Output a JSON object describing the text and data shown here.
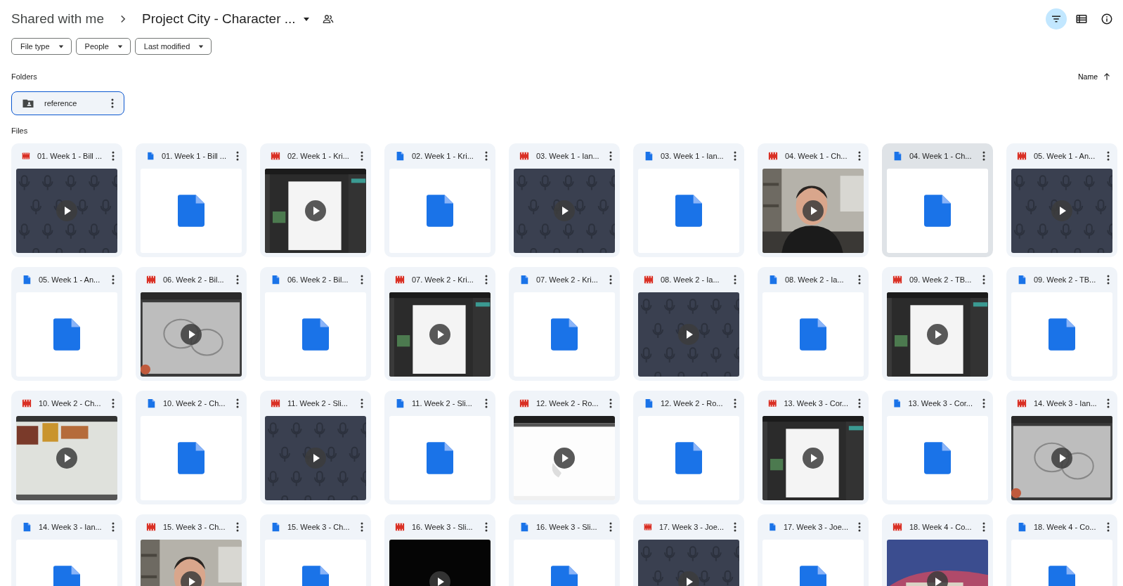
{
  "breadcrumb": [
    {
      "label": "Shared with me",
      "kind": "link"
    },
    {
      "label": "Project City - Character ...",
      "kind": "current"
    }
  ],
  "toolbar": [
    {
      "kind": "filter",
      "selected": true
    },
    {
      "kind": "list",
      "selected": false
    },
    {
      "kind": "info",
      "selected": false
    }
  ],
  "filters": [
    {
      "label": "File type"
    },
    {
      "label": "People"
    },
    {
      "label": "Last modified"
    }
  ],
  "folders_heading": "Folders",
  "sort": {
    "label": "Name"
  },
  "folders": [
    {
      "name": "reference",
      "selected": true
    }
  ],
  "files_heading": "Files",
  "files": [
    {
      "name": "01. Week 1 - Bill ...",
      "kind": "audio",
      "selected": false
    },
    {
      "name": "01. Week 1 - Bill ...",
      "kind": "doc",
      "selected": false
    },
    {
      "name": "02. Week 1 - Kri...",
      "kind": "video",
      "preview": {
        "kind": "app"
      },
      "selected": false
    },
    {
      "name": "02. Week 1 - Kri...",
      "kind": "doc",
      "selected": false
    },
    {
      "name": "03. Week 1 - Ian...",
      "kind": "audio",
      "selected": false
    },
    {
      "name": "03. Week 1 - Ian...",
      "kind": "doc",
      "selected": false
    },
    {
      "name": "04. Week 1 - Ch...",
      "kind": "video",
      "preview": {
        "kind": "room"
      },
      "selected": false
    },
    {
      "name": "04. Week 1 - Ch...",
      "kind": "doc",
      "selected": true
    },
    {
      "name": "05. Week 1 - An...",
      "kind": "audio",
      "selected": false
    },
    {
      "name": "05. Week 1 - An...",
      "kind": "doc",
      "selected": false
    },
    {
      "name": "06. Week 2 - Bil...",
      "kind": "video",
      "preview": {
        "kind": "sketch"
      },
      "selected": false
    },
    {
      "name": "06. Week 2 - Bil...",
      "kind": "doc",
      "selected": false
    },
    {
      "name": "07. Week 2 - Kri...",
      "kind": "video",
      "preview": {
        "kind": "app"
      },
      "selected": false
    },
    {
      "name": "07. Week 2 - Kri...",
      "kind": "doc",
      "selected": false
    },
    {
      "name": "08. Week 2 - Ia...",
      "kind": "audio",
      "selected": false
    },
    {
      "name": "08. Week 2 - Ia...",
      "kind": "doc",
      "selected": false
    },
    {
      "name": "09. Week 2 - TB...",
      "kind": "video",
      "preview": {
        "kind": "app"
      },
      "selected": false
    },
    {
      "name": "09. Week 2 - TB...",
      "kind": "doc",
      "selected": false
    },
    {
      "name": "10. Week 2 - Ch...",
      "kind": "video",
      "preview": {
        "kind": "collage"
      },
      "selected": false
    },
    {
      "name": "10. Week 2 - Ch...",
      "kind": "doc",
      "selected": false
    },
    {
      "name": "11. Week 2 - Sli...",
      "kind": "audio",
      "selected": false
    },
    {
      "name": "11. Week 2 - Sli...",
      "kind": "doc",
      "selected": false
    },
    {
      "name": "12. Week 2 - Ro...",
      "kind": "video",
      "preview": {
        "kind": "blank"
      },
      "selected": false
    },
    {
      "name": "12. Week 2 - Ro...",
      "kind": "doc",
      "selected": false
    },
    {
      "name": "13. Week 3 - Cor...",
      "kind": "video",
      "preview": {
        "kind": "app"
      },
      "selected": false
    },
    {
      "name": "13. Week 3 - Cor...",
      "kind": "doc",
      "selected": false
    },
    {
      "name": "14. Week 3 - Ian...",
      "kind": "video",
      "preview": {
        "kind": "sketch"
      },
      "selected": false
    },
    {
      "name": "14. Week 3 - Ian...",
      "kind": "doc",
      "selected": false
    },
    {
      "name": "15. Week 3 - Ch...",
      "kind": "video",
      "preview": {
        "kind": "room"
      },
      "selected": false
    },
    {
      "name": "15. Week 3 - Ch...",
      "kind": "doc",
      "selected": false
    },
    {
      "name": "16. Week 3 - Sli...",
      "kind": "video",
      "preview": {
        "kind": "black"
      },
      "selected": false
    },
    {
      "name": "16. Week 3 - Sli...",
      "kind": "doc",
      "selected": false
    },
    {
      "name": "17. Week 3 - Joe...",
      "kind": "audio",
      "selected": false
    },
    {
      "name": "17. Week 3 - Joe...",
      "kind": "doc",
      "selected": false
    },
    {
      "name": "18. Week 4 - Co...",
      "kind": "video",
      "preview": {
        "kind": "desktop"
      },
      "selected": false
    },
    {
      "name": "18. Week 4 - Co...",
      "kind": "doc",
      "selected": false
    }
  ]
}
